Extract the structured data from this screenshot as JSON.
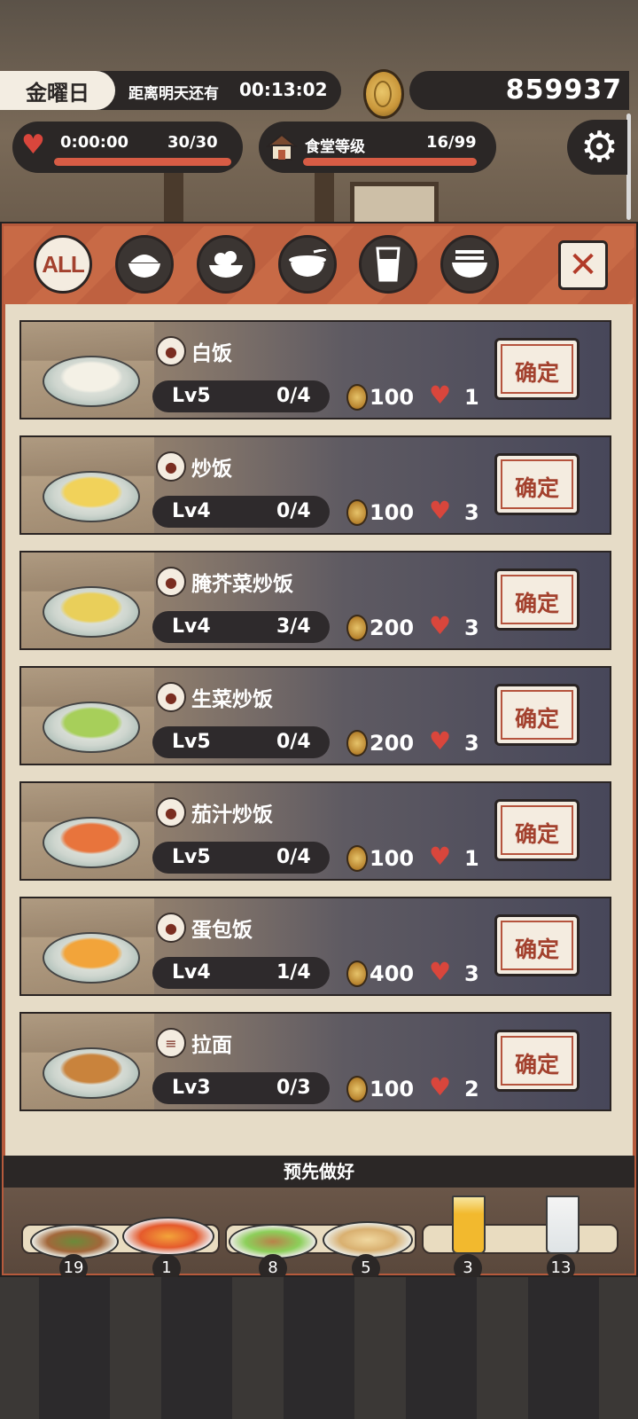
{
  "header": {
    "weekday": "金曜日",
    "countdown_label": "距离明天还有",
    "countdown_time": "00:13:02",
    "money": "859937"
  },
  "stats": {
    "heart_timer": "0:00:00",
    "heart_value": "30/30",
    "canteen_label": "食堂等级",
    "canteen_value": "16/99"
  },
  "tabs": [
    {
      "label": "ALL",
      "icon": "all-icon"
    },
    {
      "icon": "rice-bowl-icon"
    },
    {
      "icon": "side-dish-icon"
    },
    {
      "icon": "soup-bowl-icon"
    },
    {
      "icon": "drink-glass-icon"
    },
    {
      "icon": "noodle-bowl-icon"
    }
  ],
  "items": [
    {
      "name": "白饭",
      "level": "Lv5",
      "progress": "0/4",
      "price": "100",
      "hearts": "1",
      "confirm": "确定",
      "category_icon": "rice-bowl-icon",
      "color": "#f4f1e6"
    },
    {
      "name": "炒饭",
      "level": "Lv4",
      "progress": "0/4",
      "price": "100",
      "hearts": "3",
      "confirm": "确定",
      "category_icon": "rice-bowl-icon",
      "color": "#f1d25a"
    },
    {
      "name": "腌芥菜炒饭",
      "level": "Lv4",
      "progress": "3/4",
      "price": "200",
      "hearts": "3",
      "confirm": "确定",
      "category_icon": "rice-bowl-icon",
      "color": "#e9cf5a"
    },
    {
      "name": "生菜炒饭",
      "level": "Lv5",
      "progress": "0/4",
      "price": "200",
      "hearts": "3",
      "confirm": "确定",
      "category_icon": "rice-bowl-icon",
      "color": "#a7cf5a"
    },
    {
      "name": "茄汁炒饭",
      "level": "Lv5",
      "progress": "0/4",
      "price": "100",
      "hearts": "1",
      "confirm": "确定",
      "category_icon": "rice-bowl-icon",
      "color": "#e8743c"
    },
    {
      "name": "蛋包饭",
      "level": "Lv4",
      "progress": "1/4",
      "price": "400",
      "hearts": "3",
      "confirm": "确定",
      "category_icon": "rice-bowl-icon",
      "color": "#f2a43a"
    },
    {
      "name": "拉面",
      "level": "Lv3",
      "progress": "0/3",
      "price": "100",
      "hearts": "2",
      "confirm": "确定",
      "category_icon": "noodle-bowl-icon",
      "color": "#c9833c"
    }
  ],
  "premade": {
    "title": "预先做好",
    "counts": [
      "19",
      "1",
      "8",
      "5",
      "3",
      "13"
    ]
  }
}
